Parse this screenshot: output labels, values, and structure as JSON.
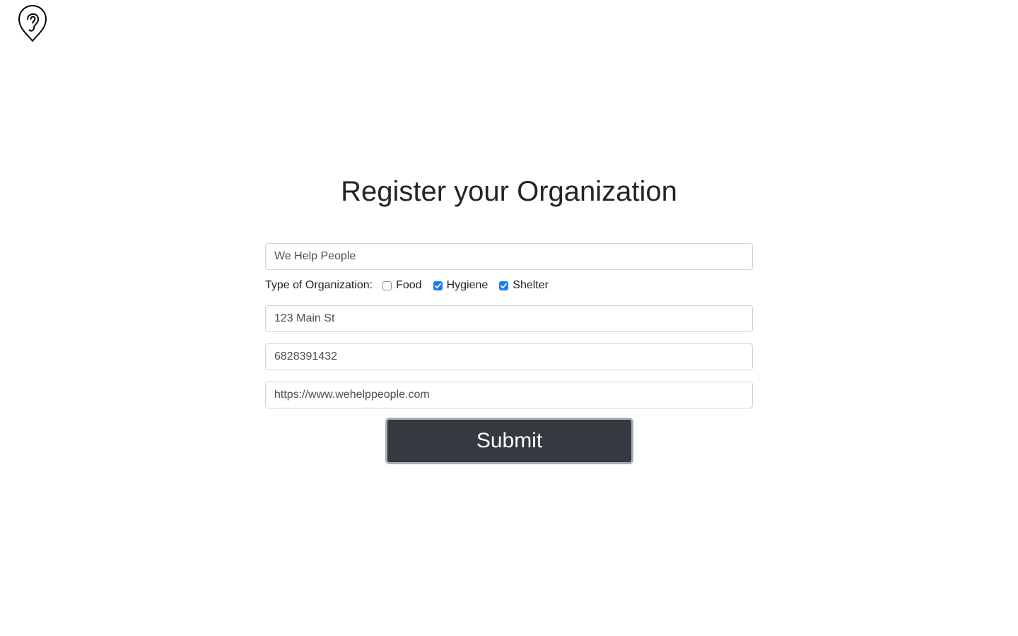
{
  "header": {
    "logo_icon": "ear-location-pin-icon"
  },
  "page": {
    "title": "Register your Organization"
  },
  "form": {
    "org_name": {
      "value": "We Help People"
    },
    "org_type": {
      "label": "Type of Organization:",
      "options": [
        {
          "label": "Food",
          "checked": false
        },
        {
          "label": "Hygiene",
          "checked": true
        },
        {
          "label": "Shelter",
          "checked": true
        }
      ]
    },
    "address": {
      "value": "123 Main St"
    },
    "phone": {
      "value": "6828391432"
    },
    "website": {
      "value": "https://www.wehelppeople.com"
    },
    "submit_label": "Submit"
  },
  "colors": {
    "accent": "#1a7ef0",
    "button_bg": "#343a40",
    "button_border": "#a8aeb4",
    "input_border": "#ced4da"
  }
}
